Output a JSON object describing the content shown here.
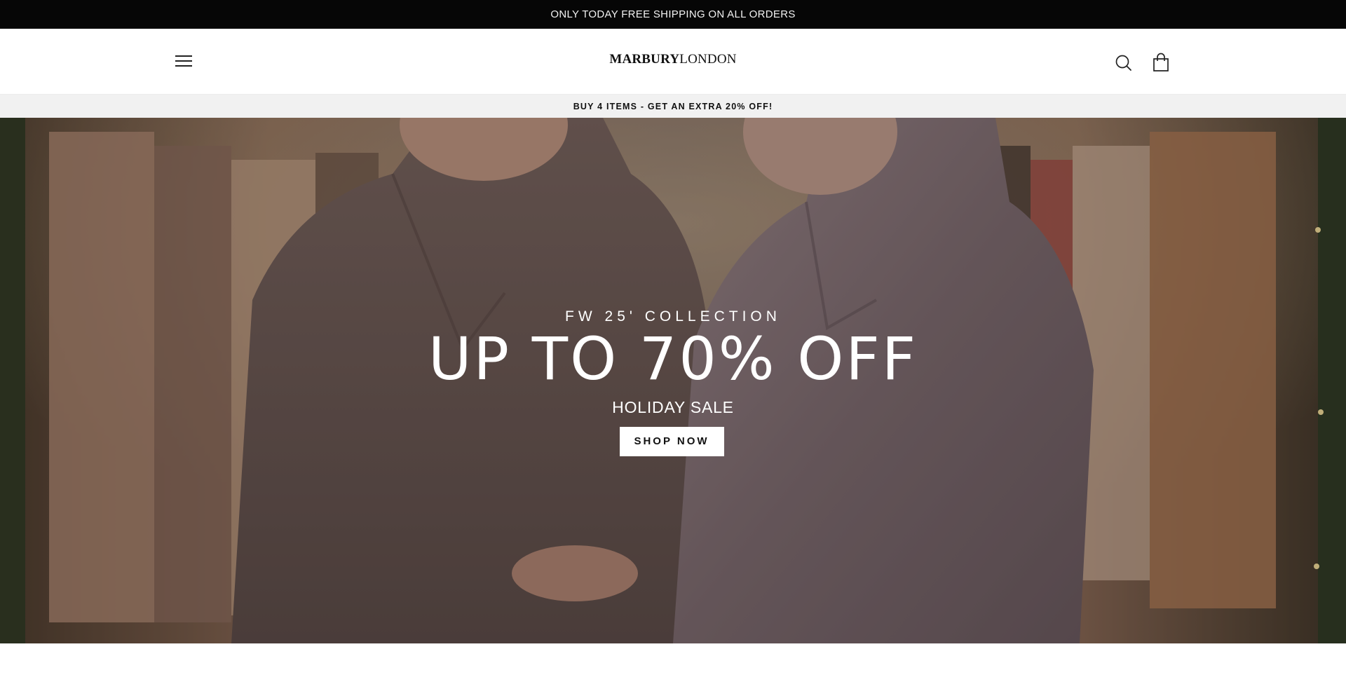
{
  "announcement": {
    "text": "ONLY TODAY FREE SHIPPING ON ALL ORDERS"
  },
  "header": {
    "logo_bold": "MARBURY",
    "logo_light": "LONDON",
    "menu_icon": "hamburger-icon",
    "search_icon": "search-icon",
    "cart_icon": "shopping-bag-icon"
  },
  "promo": {
    "text": "BUY 4 ITEMS - GET AN EXTRA 20% OFF!"
  },
  "hero": {
    "eyebrow": "FW 25' COLLECTION",
    "headline": "UP TO 70% OFF",
    "subhead": "HOLIDAY SALE",
    "cta_label": "SHOP NOW"
  },
  "colors": {
    "announcement_bg": "#060606",
    "promo_bg": "#f1f1f1",
    "button_bg": "#ffffff"
  }
}
